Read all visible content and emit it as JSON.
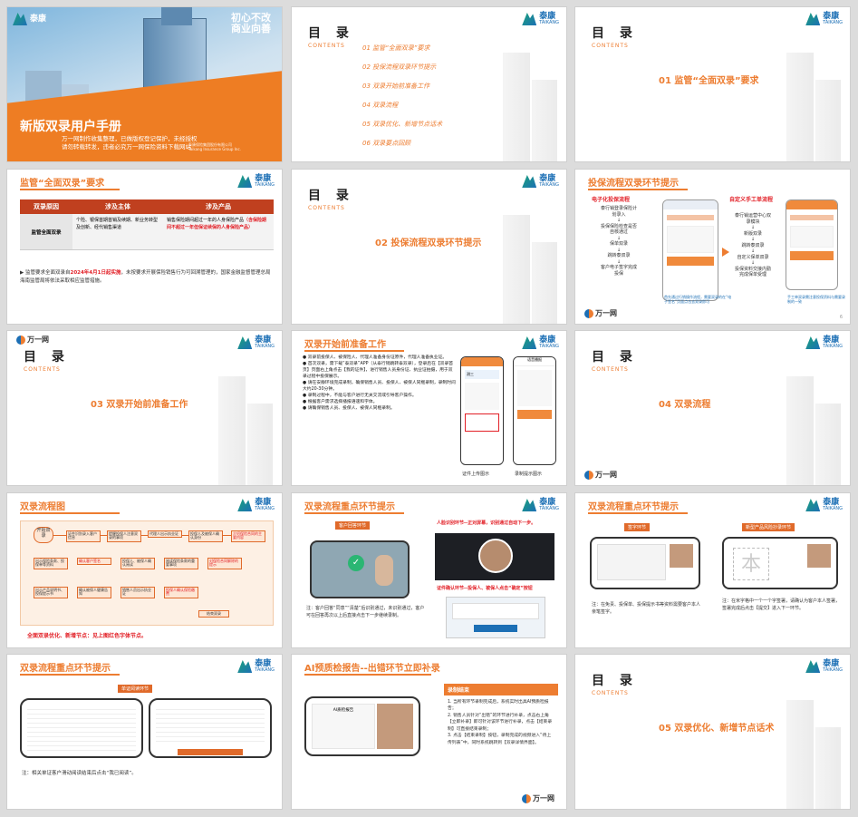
{
  "brand": {
    "cn": "泰康",
    "en": "TAIKANG",
    "wanyi": "万一网"
  },
  "cover": {
    "slogan_1": "初心不改",
    "slogan_2": "商业向善",
    "title": "新版双录用户手册",
    "sub1": "万一网制作收集整理，已做版权登记保护，未经授权",
    "sub2": "请勿转载转发，违者必究万一网保险资料下载网站",
    "company": "泰康保险集团股份有限公司",
    "company_en": "Taikang Insurance Group Inc."
  },
  "toc": {
    "heading": "目 录",
    "contents": "CONTENTS",
    "items": [
      "01  监管“全面双录”要求",
      "02  投保流程双录环节提示",
      "03  双录开始前准备工作",
      "04  双录流程",
      "05  双录优化、新增节点话术",
      "06  双录要点回顾"
    ]
  },
  "sec01": "01  监管“全面双录”要求",
  "sec02": "02  投保流程双录环节提示",
  "sec03": "03  双录开始前准备工作",
  "sec04": "04  双录流程",
  "sec05": "05  双录优化、新增节点话术",
  "reg": {
    "title": "监管“全面双录”要求",
    "headers": [
      "双录原因",
      "涉及主体",
      "涉及产品"
    ],
    "reason": "监管全面双录",
    "subject": "个险、银保首期首销及续期、新业务转型及创新、经代销售渠道",
    "product": "销售保险期间超过一年的人身保险产品",
    "product_red": "（含保险期间不超过一年但保证续保的人身保险产品）",
    "note_a": "监管要求全面双录自",
    "note_red": "2024年4月1日起实施",
    "note_b": "，未按要求开展保险销售行为可回溯管理的，国家金融监督管理总局海南监管局将依法采取相应监管措施。"
  },
  "flow2": {
    "title": "投保流程双录环节提示",
    "left_title": "电子化投保流程",
    "left_steps": [
      "泰行销登录保险计划录入",
      "投保保险检查是否自核通过",
      "保单双录",
      "跳转泰双录",
      "客户电子签字完成投保"
    ],
    "right_title": "自定义手工单流程",
    "right_steps": [
      "泰行销运营中心双录模块",
      "新版双录",
      "跳转泰双录",
      "自定义保单双录",
      "投保资料交接内勤完成保单受理"
    ],
    "left_note": "首先通过行销操作流程，需要双录的在“电子签名”页面点击去双录即可",
    "right_note": "手工单双录需注意投保资料与需要录制的一致",
    "page": "6"
  },
  "prep": {
    "title": "双录开始前准备工作",
    "bullets": [
      "双录前投保人、被保险人、代理人准备身份证原件，代理人准备执业证。",
      "首次双录，需下载“泰双录”APP（从泰行销跳转泰双录），登录后在【双录首页】页面右上角点击【我的证件】，进行销售人员身份证、执业证拍摄，用于双录过程中投保展示。",
      "请在安静环境完成录制，确保销售人员、投保人、被保人同框录制，录制时间大约20-30分钟。",
      "录制过程中，不能与客户进行无关交流或引导客户操作。",
      "根据客户需求选择播报语速和字体。",
      "请确保销售人员、投保人、被保人同框录制。"
    ],
    "cap1": "证件上传图示",
    "cap2": "录制提示图示",
    "app_name": "测三",
    "app_title": "语音播报"
  },
  "flowchart": {
    "title": "双录流程图",
    "start": "开始双录",
    "nodes": [
      "证件识别录入客户信息",
      "提醒投保人注意双录的事项",
      "代理人出示执业证",
      "投保人及被保人确认身份",
      "介绍保险合同的主要内容",
      "出示保险条款、投保单等资料",
      "确认客户签名",
      "投保人、被保人确认阅读",
      "阅读保险条款的重要事项",
      "对保险合同解除的提示",
      "出示产品说明书、投保提示书",
      "确认被保人健康告知",
      "销售人员出示执业证",
      "投保人确认保险缴费",
      "结束双录"
    ],
    "caption": "全面双录优化、新增节点：见上图红色字体节点。"
  },
  "key1": {
    "title": "双录流程重点环节提示",
    "tag_a": "客户回答环节",
    "note_a": "注：客户回答“同意”“清楚”后识别通过，未识别通过，客户可在回答再次以上后直接点击下一步继续录制。",
    "tag_b": "人脸识别环节--正对屏幕，识别通过自动下一步。",
    "tag_c": "证件确认环节--投保人、被保人点击“确定”按钮"
  },
  "key2": {
    "title": "双录流程重点环节提示",
    "tag_a": "签字环节",
    "tag_b": "新型产品风险抄录环节",
    "note_a": "注：在免责、投保单、投保提示书等资料需要客户本人亲笔签字。",
    "note_b": "注：在米字格中一个一个字签署，请确认为客户本人签署，签署完成后点击【提交】进入下一环节。",
    "glyph": "本"
  },
  "key3": {
    "title": "双录流程重点环节提示",
    "tag": "单证阅读环节",
    "note": "注：相关单证客户滑动阅读结束后点击“我已阅读”。"
  },
  "ai": {
    "title": "AI预质检报告--出错环节立即补录",
    "box_title": "录制结束",
    "items": [
      "1. 当所有环节录制完成后，系统实时出具AI预质检报告；",
      "2. 销售人员针对“出错”的环节进行补录，点击右上角【立即补录】即可针对该环节进行补录，点击【结束录制】可直接结束录制；",
      "3. 点击【结束录制】按钮，录制完成的视频进入“待上传列表”中，同时系统跳转到【双录详情界面】。"
    ],
    "screen_title": "AI质检报告"
  }
}
